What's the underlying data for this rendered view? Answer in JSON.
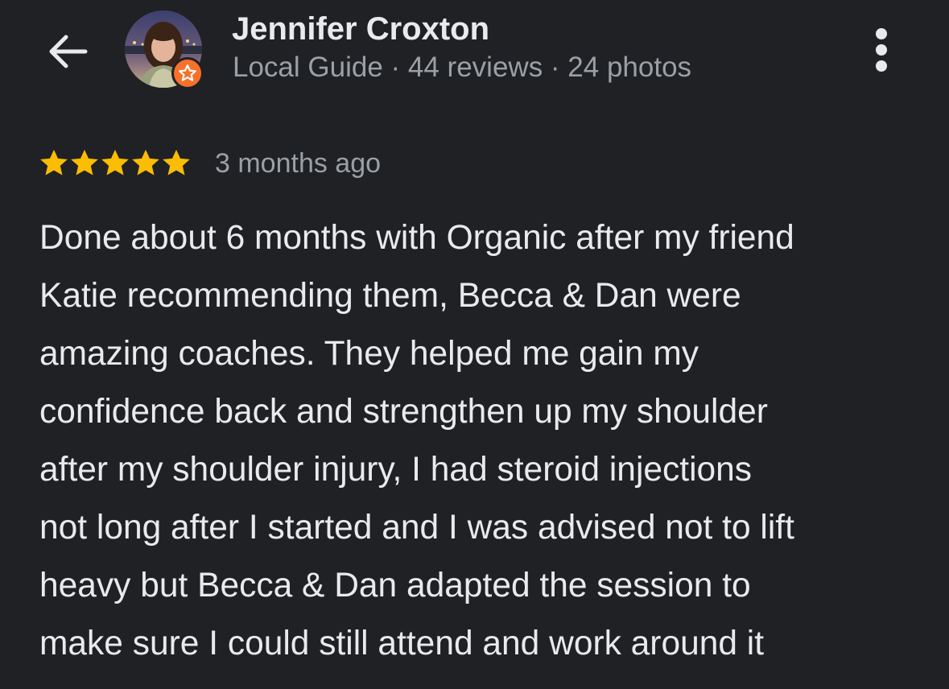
{
  "header": {
    "back_icon": "arrow-left-icon",
    "more_icon": "more-vertical-icon",
    "reviewer": {
      "name": "Jennifer Croxton",
      "meta": "Local Guide · 44 reviews · 24 photos",
      "badge_icon": "star-badge-icon",
      "badge_color": "#f7712a"
    }
  },
  "review": {
    "rating": 5,
    "max_rating": 5,
    "star_color": "#fbbc04",
    "time": "3 months ago",
    "lines": [
      "Done about 6 months with Organic after my friend",
      "Katie recommending them, Becca & Dan were",
      "amazing coaches. They helped me gain my",
      "confidence back and strengthen up my shoulder",
      "after my shoulder injury, I had steroid injections",
      "not long after I started and I was advised not to lift",
      "heavy but Becca & Dan adapted the session to",
      "make sure I could still attend and work around it"
    ]
  },
  "colors": {
    "background": "#202124",
    "primary_text": "#e8eaed",
    "secondary_text": "#9aa0a6"
  }
}
